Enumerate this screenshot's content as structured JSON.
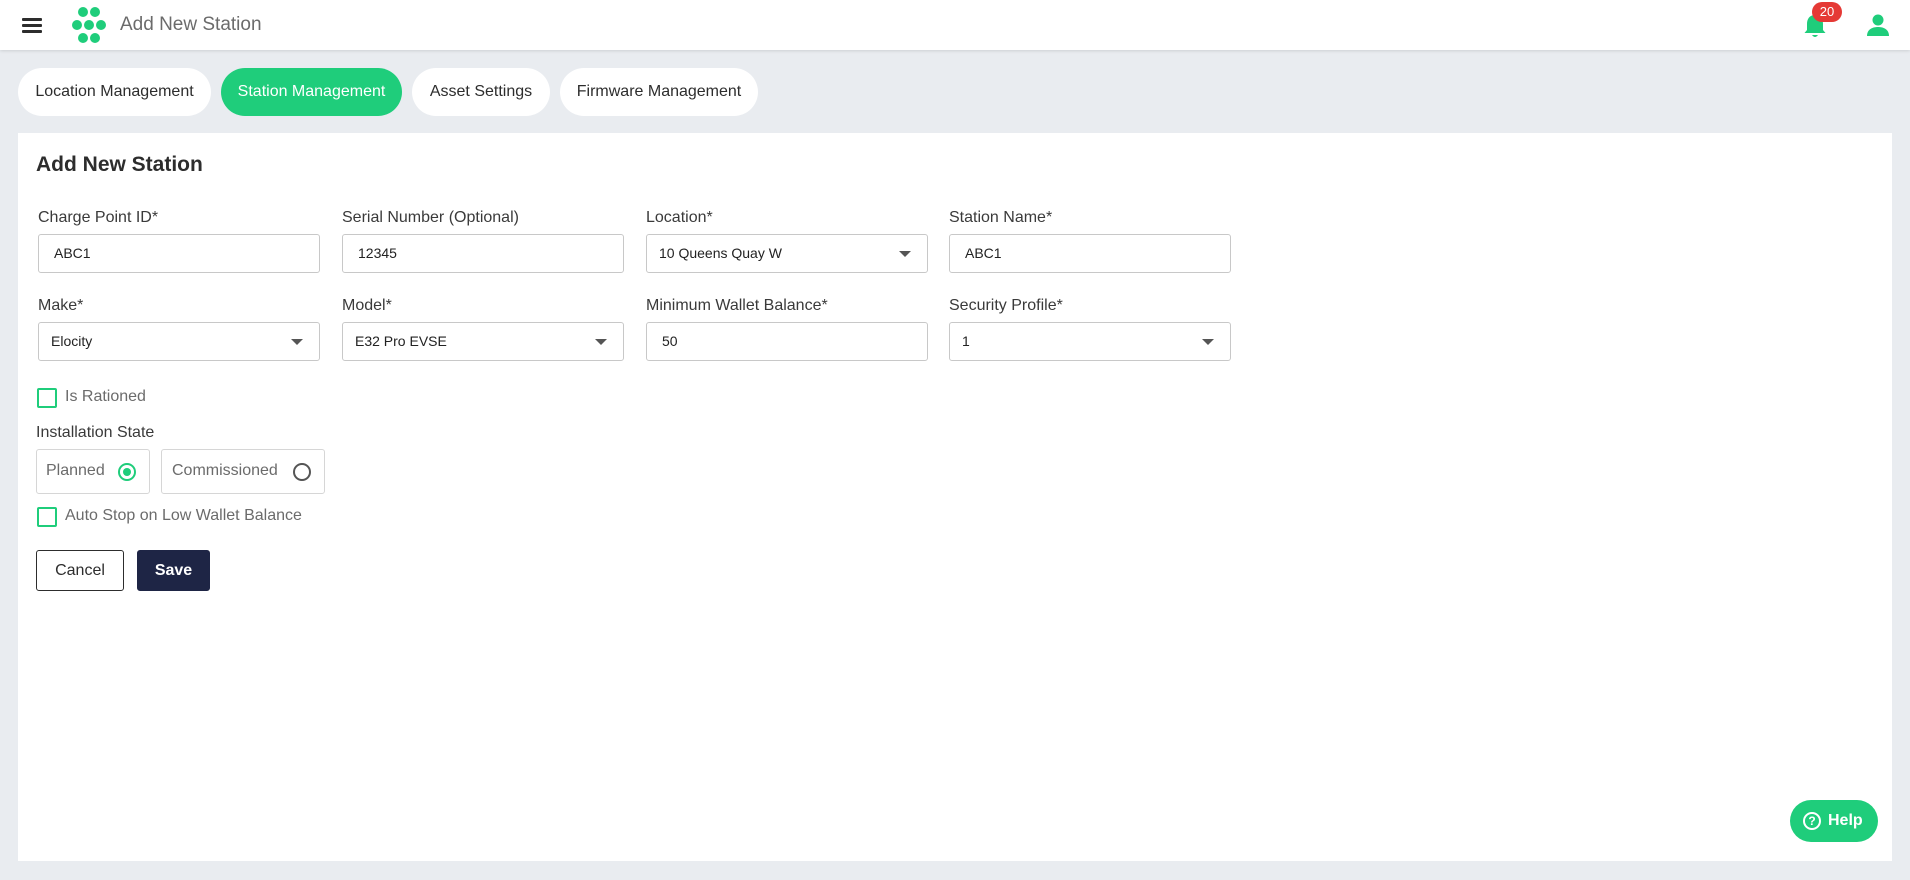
{
  "header": {
    "title": "Add New Station",
    "notification_count": "20",
    "icons": {
      "menu": "menu-icon",
      "logo": "logo-icon",
      "bell": "bell-icon",
      "user": "user-icon"
    }
  },
  "tabs": [
    {
      "label": "Location Management",
      "active": false
    },
    {
      "label": "Station Management",
      "active": true
    },
    {
      "label": "Asset Settings",
      "active": false
    },
    {
      "label": "Firmware Management",
      "active": false
    }
  ],
  "form": {
    "title": "Add New Station",
    "fields": {
      "charge_point_id": {
        "label": "Charge Point ID*",
        "value": "ABC1"
      },
      "serial_number": {
        "label": "Serial Number (Optional)",
        "value": "12345"
      },
      "location": {
        "label": "Location*",
        "value": "10 Queens Quay W"
      },
      "station_name": {
        "label": "Station Name*",
        "value": "ABC1"
      },
      "make": {
        "label": "Make*",
        "value": "Elocity"
      },
      "model": {
        "label": "Model*",
        "value": "E32 Pro EVSE"
      },
      "min_wallet_balance": {
        "label": "Minimum Wallet Balance*",
        "value": "50"
      },
      "security_profile": {
        "label": "Security Profile*",
        "value": "1"
      }
    },
    "is_rationed": {
      "label": "Is Rationed",
      "checked": false
    },
    "installation_state": {
      "label": "Installation State",
      "options": [
        {
          "label": "Planned",
          "selected": true
        },
        {
          "label": "Commissioned",
          "selected": false
        }
      ]
    },
    "auto_stop": {
      "label": "Auto Stop on Low Wallet Balance",
      "checked": false
    },
    "cancel_label": "Cancel",
    "save_label": "Save"
  },
  "help": {
    "label": "Help"
  },
  "colors": {
    "accent": "#1fcd7b",
    "primary_dark": "#1e2545",
    "badge": "#e53935",
    "background": "#e9ecf0"
  }
}
